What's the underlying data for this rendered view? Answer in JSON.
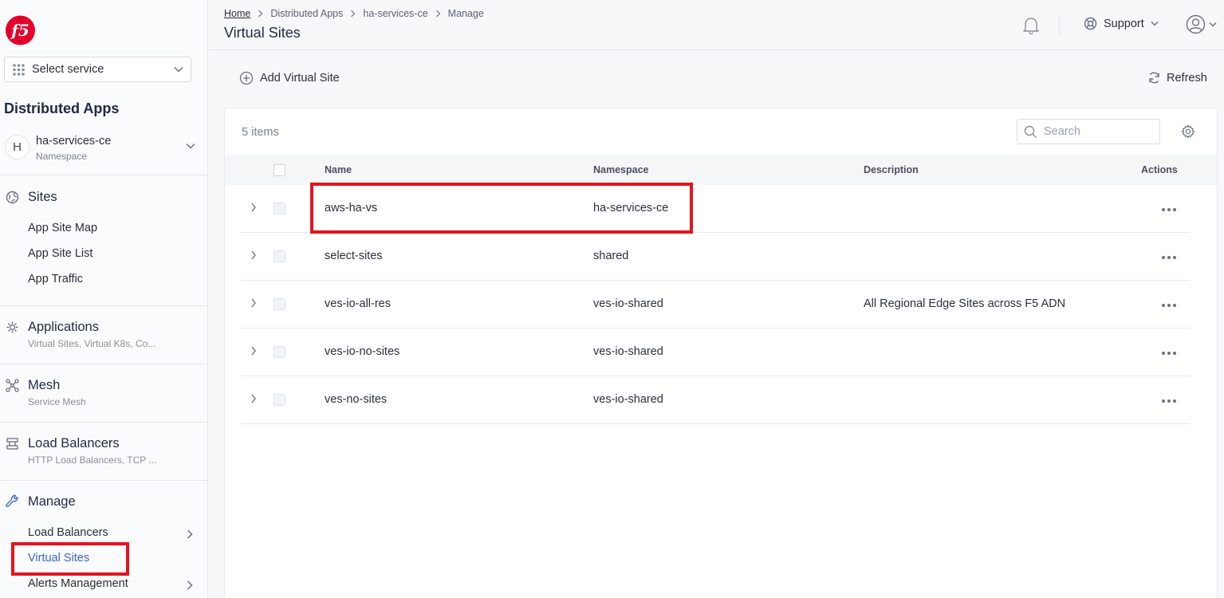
{
  "sidebar": {
    "service_select": {
      "label": "Select service"
    },
    "app_title": "Distributed Apps",
    "namespace": {
      "avatar_letter": "H",
      "name": "ha-services-ce",
      "sublabel": "Namespace"
    },
    "sites": {
      "heading": "Sites",
      "items": [
        {
          "label": "App Site Map"
        },
        {
          "label": "App Site List"
        },
        {
          "label": "App Traffic"
        }
      ]
    },
    "applications": {
      "heading": "Applications",
      "sub": "Virtual Sites, Virtual K8s, Co..."
    },
    "mesh": {
      "heading": "Mesh",
      "sub": "Service Mesh"
    },
    "load_balancers": {
      "heading": "Load Balancers",
      "sub": "HTTP Load Balancers, TCP ..."
    },
    "manage": {
      "heading": "Manage",
      "items": [
        {
          "label": "Load Balancers",
          "has_children": true
        },
        {
          "label": "Virtual Sites",
          "active": true
        },
        {
          "label": "Alerts Management",
          "has_children": true
        }
      ]
    }
  },
  "header": {
    "breadcrumbs": [
      "Home",
      "Distributed Apps",
      "ha-services-ce",
      "Manage"
    ],
    "title": "Virtual Sites",
    "support_label": "Support"
  },
  "toolbar": {
    "add_label": "Add Virtual Site",
    "refresh_label": "Refresh"
  },
  "table": {
    "count_label": "5 items",
    "search_placeholder": "Search",
    "columns": [
      "Name",
      "Namespace",
      "Description",
      "Actions"
    ],
    "rows": [
      {
        "name": "aws-ha-vs",
        "namespace": "ha-services-ce",
        "description": ""
      },
      {
        "name": "select-sites",
        "namespace": "shared",
        "description": ""
      },
      {
        "name": "ves-io-all-res",
        "namespace": "ves-io-shared",
        "description": "All Regional Edge Sites across F5 ADN"
      },
      {
        "name": "ves-io-no-sites",
        "namespace": "ves-io-shared",
        "description": ""
      },
      {
        "name": "ves-no-sites",
        "namespace": "ves-io-shared",
        "description": ""
      }
    ]
  },
  "colors": {
    "brand_red": "#e4002b",
    "highlight_red": "#e3141d",
    "active_link": "#3b63c9"
  },
  "icons": [
    "f5-logo",
    "grid-icon",
    "chevron-down-icon",
    "globe-icon",
    "gear-cluster-icon",
    "mesh-icon",
    "load-balancer-icon",
    "wrench-icon",
    "chevron-right-icon",
    "bell-icon",
    "support-icon",
    "user-icon",
    "plus-circle-icon",
    "refresh-icon",
    "search-icon",
    "settings-icon",
    "more-icon"
  ]
}
